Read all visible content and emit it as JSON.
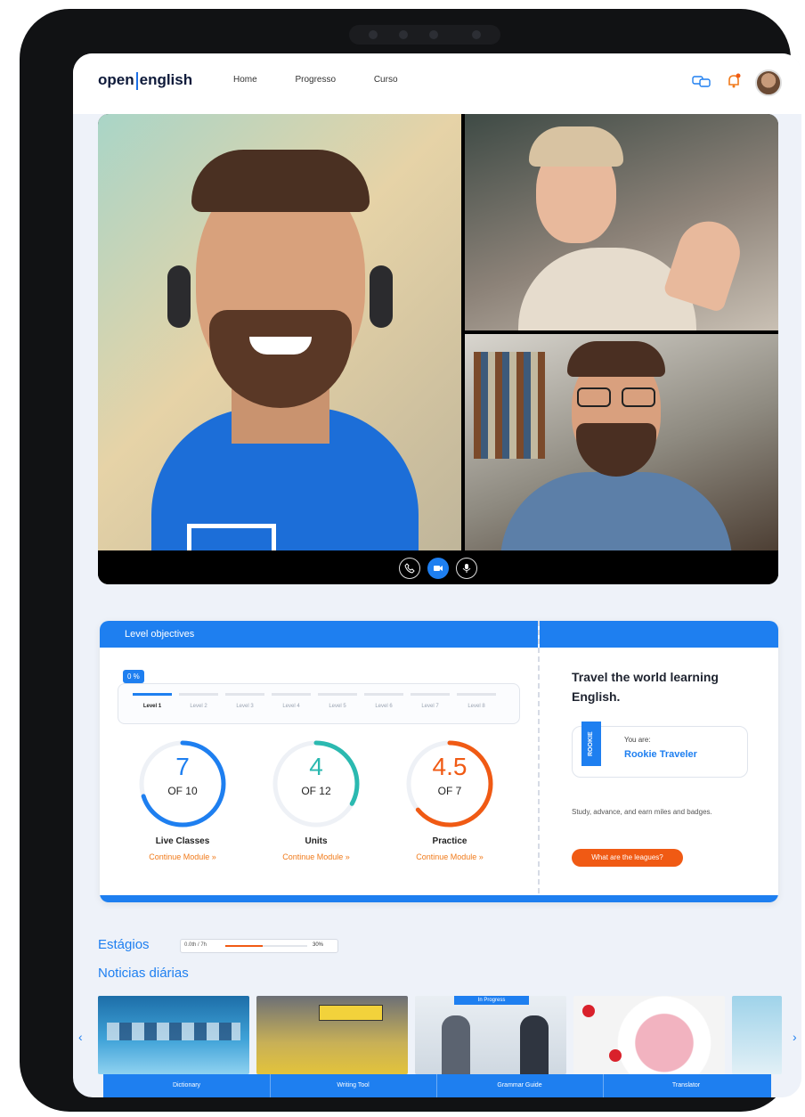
{
  "brand": {
    "logo_left": "open",
    "logo_right": "english"
  },
  "nav": {
    "items": [
      "Home",
      "Progresso",
      "Curso"
    ]
  },
  "call_controls": {
    "phone": "phone",
    "video": "video",
    "mic": "mic"
  },
  "level_objectives": {
    "title": "Level objectives",
    "progress_badge": "0 %",
    "levels": [
      "Level 1",
      "Level 2",
      "Level 3",
      "Level 4",
      "Level 5",
      "Level 6",
      "Level 7",
      "Level 8"
    ],
    "metrics": [
      {
        "value": "7",
        "of": "OF 10",
        "title": "Live Classes",
        "link": "Continue Module »",
        "fraction": 0.7,
        "color": "#1e7ff0"
      },
      {
        "value": "4",
        "of": "OF 12",
        "title": "Units",
        "link": "Continue Module »",
        "fraction": 0.33,
        "color": "#2bb9b0"
      },
      {
        "value": "4.5",
        "of": "OF 7",
        "title": "Practice",
        "link": "Continue Module »",
        "fraction": 0.64,
        "color": "#f05a14"
      }
    ]
  },
  "travel": {
    "title": "Travel the world learning English.",
    "badge": "ROOKIE",
    "you_are": "You are:",
    "rank": "Rookie Traveler",
    "body": "Study, advance, and earn miles and badges.",
    "button": "What are the leagues?"
  },
  "stages": {
    "title": "Estágios",
    "left": "0.0th / 7h",
    "right": "30%"
  },
  "news": {
    "title": "Noticias diárias",
    "in_progress_label": "In Progress"
  },
  "tabs": [
    "Dictionary",
    "Writing Tool",
    "Grammar Guide",
    "Translator"
  ],
  "colors": {
    "accent": "#1e7ff0",
    "orange": "#f05a14",
    "teal": "#2bb9b0"
  }
}
